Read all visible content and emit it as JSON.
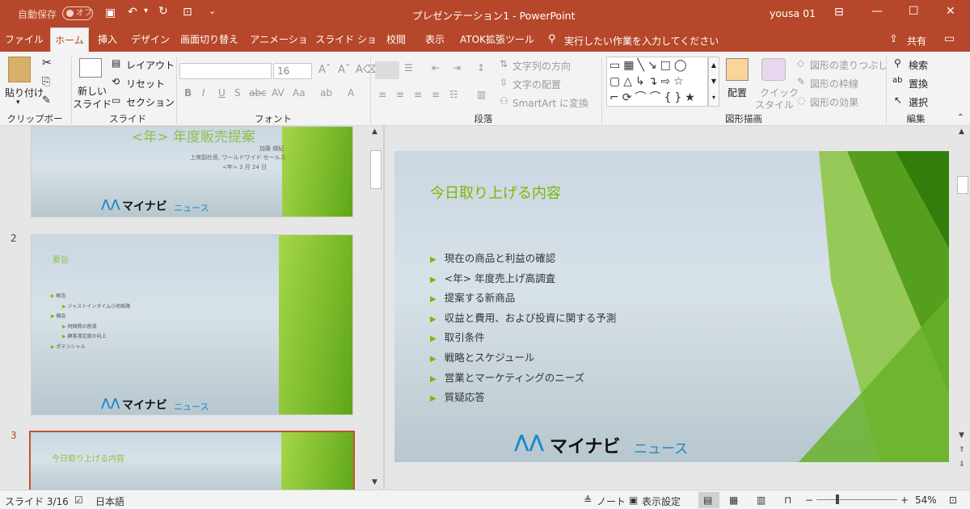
{
  "titlebar": {
    "autosave": "自動保存",
    "autosave_state": "オフ",
    "title": "プレゼンテーション1 - PowerPoint",
    "user": "yousa 01"
  },
  "tabs": [
    "ファイル",
    "ホーム",
    "挿入",
    "デザイン",
    "画面切り替え",
    "アニメーション",
    "スライド ショー",
    "校閲",
    "表示",
    "ATOK拡張ツール"
  ],
  "tellme": "実行したい作業を入力してください",
  "share": "共有",
  "ribbon": {
    "clipboard": {
      "paste": "貼り付け",
      "group": "クリップボード"
    },
    "slides": {
      "new_slide_1": "新しい",
      "new_slide_2": "スライド",
      "layout": "レイアウト",
      "reset": "リセット",
      "section": "セクション",
      "group": "スライド"
    },
    "font": {
      "size": "16",
      "group": "フォント"
    },
    "paragraph": {
      "text_direction": "文字列の方向",
      "align_text": "文字の配置",
      "smartart": "SmartArt に変換",
      "group": "段落"
    },
    "drawing": {
      "arrange": "配置",
      "quick_style_1": "クイック",
      "quick_style_2": "スタイル",
      "fill": "図形の塗りつぶし",
      "outline": "図形の枠線",
      "effects": "図形の効果",
      "group": "図形描画"
    },
    "editing": {
      "find": "検索",
      "replace": "置換",
      "select": "選択",
      "group": "編集"
    }
  },
  "thumbs": {
    "t1": {
      "title": "<年> 年度販売提案",
      "line1": "加藤 順紀",
      "line2": "上席副社長, ワールドワイド セールス",
      "line3": "<年> 3 月 24 日"
    },
    "t2": {
      "number": "2",
      "title": "要旨",
      "bullets": [
        "概念",
        "ジャストインタイム小売販路",
        "機会",
        "同梱費の削減",
        "顧客満足度の向上",
        "ポテンシャル"
      ]
    },
    "t3": {
      "number": "3",
      "title": "今日取り上げる内容"
    }
  },
  "logo": {
    "main": "マイナビ",
    "sub": "ニュース"
  },
  "main_slide": {
    "title": "今日取り上げる内容",
    "bullets": [
      "現在の商品と利益の確認",
      "<年> 年度売上げ高調査",
      "提案する新商品",
      "収益と費用、および投資に関する予測",
      "取引条件",
      "戦略とスケジュール",
      "営業とマーケティングのニーズ",
      "質疑応答"
    ]
  },
  "status": {
    "slide": "スライド 3/16",
    "language": "日本語",
    "notes": "ノート",
    "view_settings": "表示設定",
    "zoom": "54%"
  },
  "colors": {
    "accent": "#b7472a",
    "green": "#7ab800"
  }
}
